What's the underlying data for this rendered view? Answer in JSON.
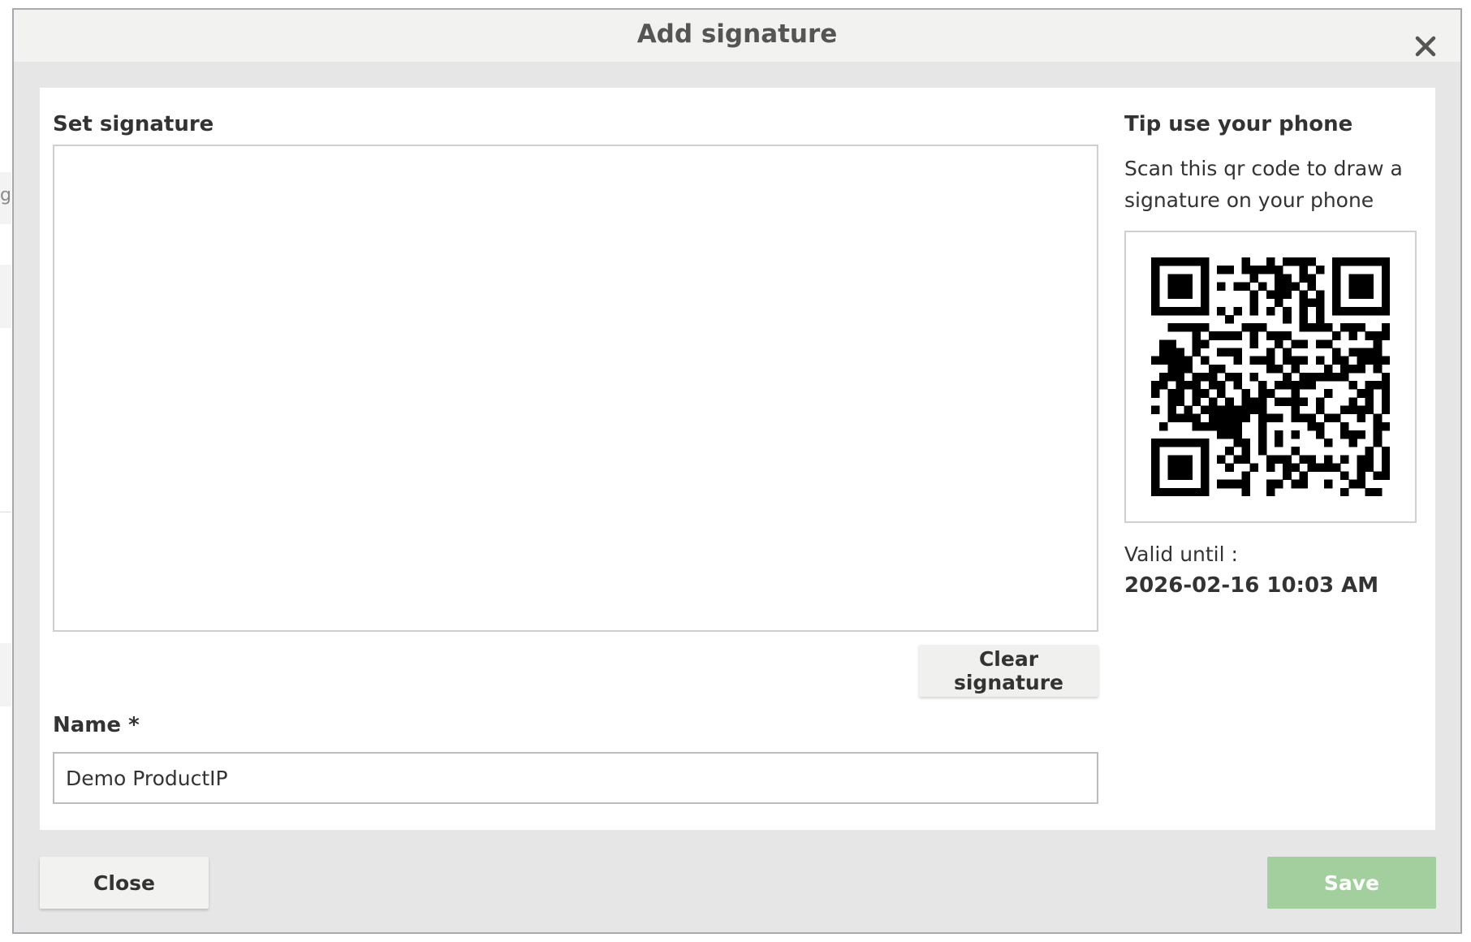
{
  "dialog": {
    "title": "Add signature",
    "close_icon": "close-x-icon"
  },
  "signature": {
    "label": "Set signature",
    "clear_label": "Clear signature"
  },
  "name_field": {
    "label": "Name *",
    "value": "Demo ProductIP"
  },
  "tip": {
    "title": "Tip use your phone",
    "text": "Scan this qr code to draw a signature on your phone",
    "qr_icon": "qr-code-icon",
    "valid_label": "Valid until :",
    "valid_date": "2026-02-16 10:03 AM"
  },
  "footer": {
    "close_label": "Close",
    "save_label": "Save"
  },
  "background": {
    "partial_text": "gs"
  },
  "colors": {
    "save_disabled": "#a3cf9e",
    "overlay": "#e6e6e6",
    "header": "#f2f2f1"
  }
}
